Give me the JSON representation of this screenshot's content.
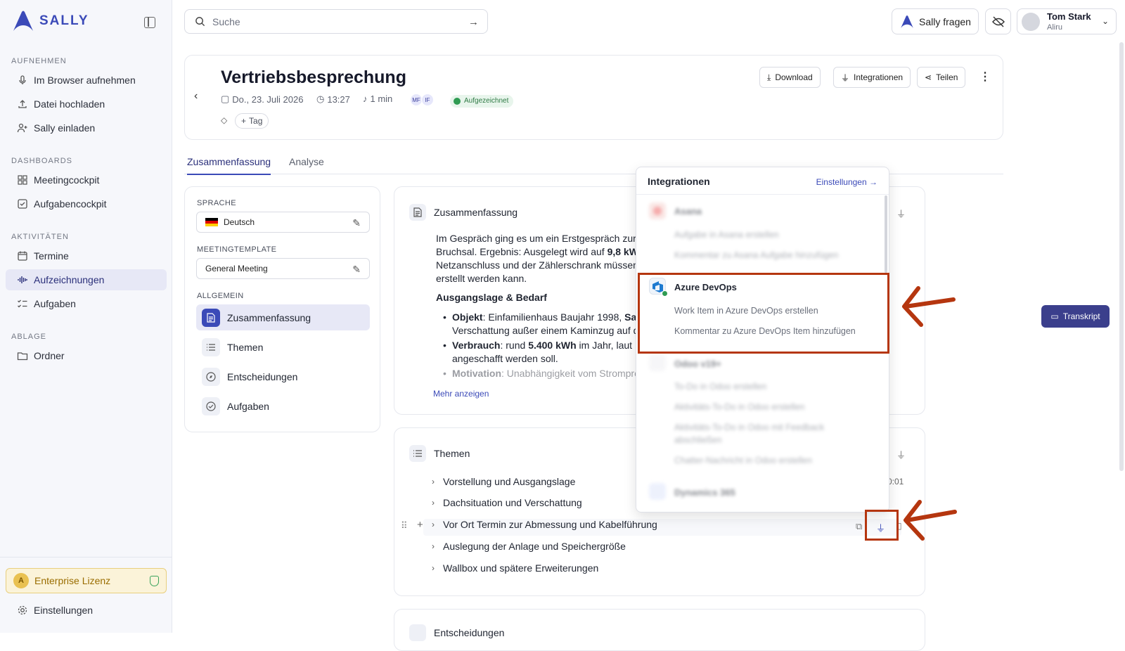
{
  "app": {
    "name": "SALLY"
  },
  "sidebar": {
    "sections": {
      "aufnehmen": "AUFNEHMEN",
      "dashboards": "DASHBOARDS",
      "aktivitaeten": "AKTIVITÄTEN",
      "ablage": "ABLAGE"
    },
    "items": {
      "browser": "Im Browser aufnehmen",
      "upload": "Datei hochladen",
      "invite": "Sally einladen",
      "meetingcockpit": "Meetingcockpit",
      "aufgabencockpit": "Aufgabencockpit",
      "termine": "Termine",
      "aufzeichnungen": "Aufzeichnungen",
      "aufgaben": "Aufgaben",
      "ordner": "Ordner"
    },
    "license": "Enterprise Lizenz",
    "settings": "Einstellungen"
  },
  "topbar": {
    "search_placeholder": "Suche",
    "ask": "Sally fragen",
    "user_name": "Tom Stark",
    "user_org": "Aliru"
  },
  "meeting": {
    "title": "Vertriebsbesprechung",
    "date": "Do., 23. Juli 2026",
    "time": "13:27",
    "duration": "1 min",
    "avatars": [
      "MF",
      "IF"
    ],
    "status": "Aufgezeichnet",
    "tag_label": "Tag",
    "actions": {
      "download": "Download",
      "integrations": "Integrationen",
      "share": "Teilen"
    }
  },
  "tabs": {
    "summary": "Zusammenfassung",
    "analysis": "Analyse"
  },
  "left_panel": {
    "language_label": "SPRACHE",
    "language": "Deutsch",
    "template_label": "MEETINGTEMPLATE",
    "template": "General Meeting",
    "general_label": "ALLGEMEIN",
    "outline": {
      "summary": "Zusammenfassung",
      "topics": "Themen",
      "decisions": "Entscheidungen",
      "tasks": "Aufgaben"
    }
  },
  "summary": {
    "title": "Zusammenfassung",
    "p1": "Im Gespräch ging es um ein Erstgespräch zur g",
    "p2a": "Bruchsal. Ergebnis: Ausgelegt wird auf ",
    "p2b": "9,8 kW",
    "p3": "Netzanschluss und der Zählerschrank müssen",
    "p4": "erstellt werden kann.",
    "h1": "Ausgangslage & Bedarf",
    "b1k": "Objekt",
    "b1": ": Einfamilienhaus Baujahr 1998, ",
    "b1b": "Satt",
    "b1c": "Verschattung außer einem Kaminzug auf d",
    "b2k": "Verbrauch",
    "b2": ": rund ",
    "b2b": "5.400 kWh",
    "b2c": " im Jahr, laut Fr",
    "b2d": "angeschafft werden soll.",
    "b3k": "Motivation",
    "b3": ": Unabhängigkeit vom Strompre",
    "more": "Mehr anzeigen"
  },
  "topics": {
    "title": "Themen",
    "time_fragment": "0:01",
    "items": [
      "Vorstellung und Ausgangslage",
      "Dachsituation und Verschattung",
      "Vor Ort Termin zur Abmessung und Kabelführung",
      "Auslegung der Anlage und Speichergröße",
      "Wallbox und spätere Erweiterungen"
    ]
  },
  "decisions": {
    "title": "Entscheidungen"
  },
  "transcript_button": "Transkript",
  "integrations_dropdown": {
    "title": "Integrationen",
    "settings": "Einstellungen",
    "asana": {
      "name": "Asana",
      "a1": "Aufgabe in Asana erstellen",
      "a2": "Kommentar zu Asana Aufgabe hinzufügen"
    },
    "azure": {
      "name": "Azure DevOps",
      "a1": "Work Item in Azure DevOps erstellen",
      "a2": "Kommentar zu Azure DevOps Item hinzufügen"
    },
    "odoo": {
      "name": "Odoo v19+",
      "a1": "To-Do in Odoo erstellen",
      "a2": "Aktivitäts-To-Do in Odoo erstellen",
      "a3a": "Aktivitäts-To-Do in Odoo mit Feedback",
      "a3b": "abschließen",
      "a4": "Chatter-Nachricht in Odoo erstellen"
    },
    "dynamics": {
      "name": "Dynamics 365"
    }
  },
  "colors": {
    "accent": "#3b4ab8",
    "annotation": "#b5360f",
    "success": "#2f9b52"
  }
}
